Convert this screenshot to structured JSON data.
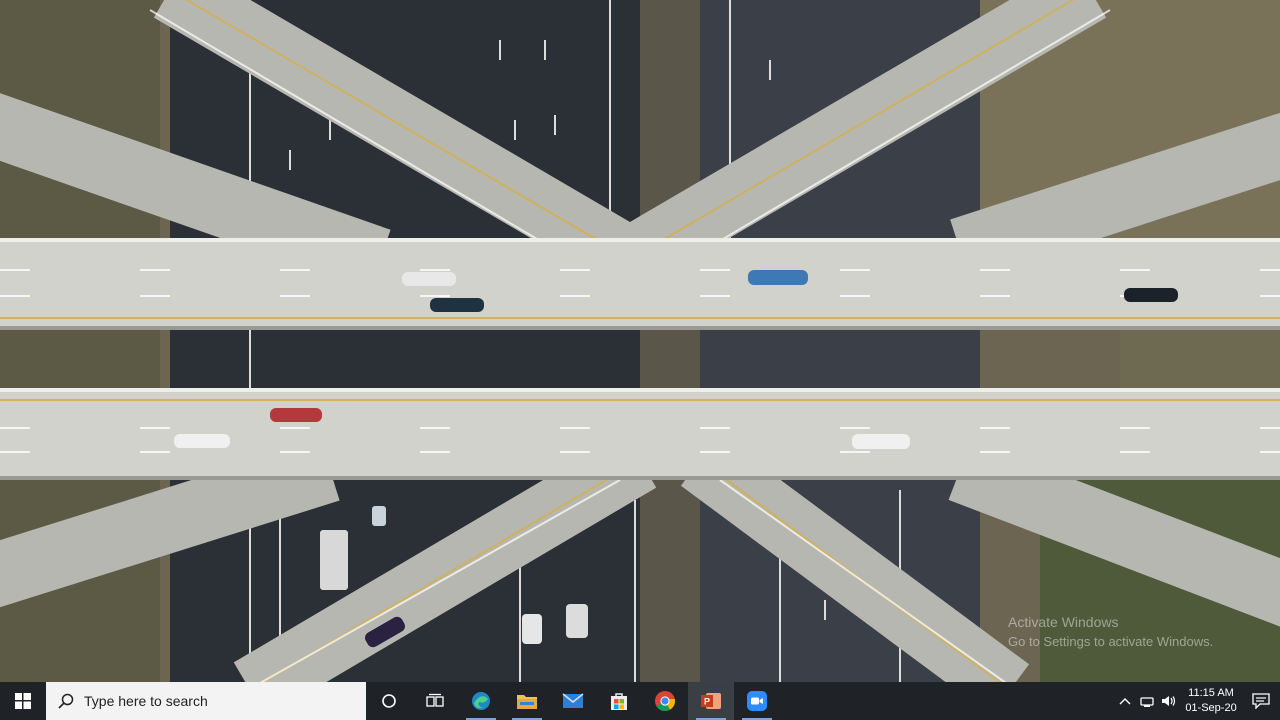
{
  "desktop": {
    "wallpaper": "aerial highway interchange",
    "watermark": {
      "title": "Activate Windows",
      "subtitle": "Go to Settings to activate Windows."
    }
  },
  "taskbar": {
    "search_placeholder": "Type here to search",
    "apps": [
      {
        "name": "cortana-icon"
      },
      {
        "name": "task-view-icon"
      },
      {
        "name": "edge-icon"
      },
      {
        "name": "file-explorer-icon"
      },
      {
        "name": "mail-icon"
      },
      {
        "name": "microsoft-store-icon"
      },
      {
        "name": "chrome-icon"
      },
      {
        "name": "powerpoint-icon"
      },
      {
        "name": "zoom-icon"
      }
    ],
    "clock": {
      "time": "11:15 AM",
      "date": "01-Sep-20"
    }
  },
  "colors": {
    "taskbar": "#1f2327",
    "search_bg": "#f3f3f3",
    "road": "#c9c9c4",
    "asphalt": "#2b2f36"
  }
}
